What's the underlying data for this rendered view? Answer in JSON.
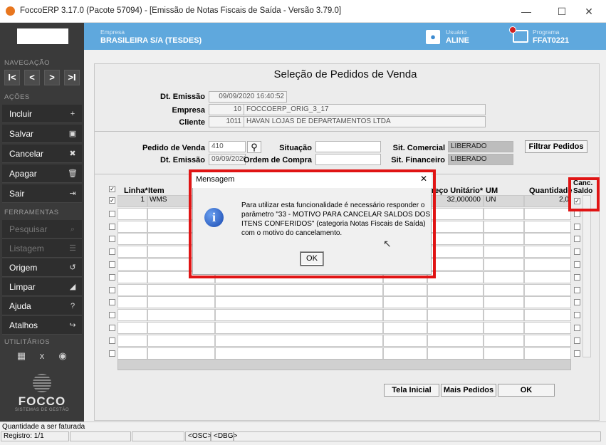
{
  "window": {
    "title": "FoccoERP 3.17.0 (Pacote 57094) - [Emissão de Notas Fiscais de Saída - Versão 3.79.0]",
    "minimize": "—",
    "maximize": "☐",
    "close": "✕"
  },
  "sidebar": {
    "nav_title": "NAVEGAÇÃO",
    "nav_buttons": [
      "I<",
      "<",
      ">",
      ">I"
    ],
    "actions_title": "AÇÕES",
    "actions": [
      {
        "label": "Incluir",
        "icon": "+"
      },
      {
        "label": "Salvar",
        "icon": "▣"
      },
      {
        "label": "Cancelar",
        "icon": "✖"
      },
      {
        "label": "Apagar",
        "icon": "🗑"
      },
      {
        "label": "Sair",
        "icon": "⇥"
      }
    ],
    "tools_title": "FERRAMENTAS",
    "tools": [
      {
        "label": "Pesquisar",
        "icon": "⌕"
      },
      {
        "label": "Listagem",
        "icon": "☰"
      },
      {
        "label": "Origem",
        "icon": "↺"
      },
      {
        "label": "Limpar",
        "icon": "◢"
      },
      {
        "label": "Ajuda",
        "icon": "?"
      },
      {
        "label": "Atalhos",
        "icon": "↪"
      }
    ],
    "utils_title": "UTILITÁRIOS",
    "utils_icons": [
      "▦",
      "x",
      "◉"
    ],
    "brand": "FOCCO",
    "brand_sub": "SISTEMAS DE GESTÃO"
  },
  "header": {
    "empresa_label": "Empresa",
    "empresa_value": "BRASILEIRA S/A (TESDES)",
    "usuario_label": "Usuário",
    "usuario_value": "ALINE",
    "programa_label": "Programa",
    "programa_value": "FFAT0221"
  },
  "form": {
    "title": "Seleção de Pedidos de Venda",
    "dt_emissao_label": "Dt. Emissão",
    "dt_emissao_value": "09/09/2020 16:40:52",
    "empresa_label": "Empresa",
    "empresa_code": "10",
    "empresa_name": "FOCCOERP_ORIG_3_17",
    "cliente_label": "Cliente",
    "cliente_code": "1011",
    "cliente_name": "HAVAN LOJAS DE DEPARTAMENTOS LTDA",
    "pedido_label": "Pedido de Venda",
    "pedido_value": "410",
    "dt_emissao2_label": "Dt. Emissão",
    "dt_emissao2_value": "09/09/2020",
    "situacao_label": "Situação",
    "situacao_value": "",
    "ordem_label": "Ordem de Compra",
    "ordem_value": "",
    "sit_comercial_label": "Sit. Comercial",
    "sit_comercial_value": "LIBERADO",
    "sit_financeiro_label": "Sit. Financeiro",
    "sit_financeiro_value": "LIBERADO",
    "filtrar_button": "Filtrar Pedidos"
  },
  "grid": {
    "headers": {
      "linha": "Linha*",
      "item": "Item",
      "preco": "reço Unitário*",
      "um": "UM",
      "quantidade": "Quantidade",
      "canc": "Canc.",
      "saldo": "Saldo"
    },
    "row1": {
      "check": "✓",
      "linha": "1",
      "item": "WMS",
      "preco": "32,000000",
      "um": "UN",
      "quantidade": "2,0",
      "canc": "✓"
    }
  },
  "modal": {
    "title": "Mensagem",
    "close": "✕",
    "icon": "i",
    "message_lines": [
      "Para utilizar esta funcionalidade é necessário responder o",
      "parâmetro \"33 - MOTIVO PARA CANCELAR SALDOS DOS",
      "ITENS CONFERIDOS\" (categoria Notas Fiscais de Saída)",
      "com o motivo do cancelamento."
    ],
    "ok": "OK"
  },
  "footer_buttons": {
    "tela_inicial": "Tela Inicial",
    "mais_pedidos": "Mais Pedidos",
    "ok": "OK"
  },
  "status": {
    "hint": "Quantidade a ser faturada",
    "registro": "Registro: 1/1",
    "osc": "<OSC>",
    "dbg": "<DBG>"
  },
  "colors": {
    "header_blue": "#5fa8dd",
    "sidebar_dark": "#3a3a3a",
    "highlight_red": "#e01414",
    "accent_orange": "#e8761e"
  }
}
